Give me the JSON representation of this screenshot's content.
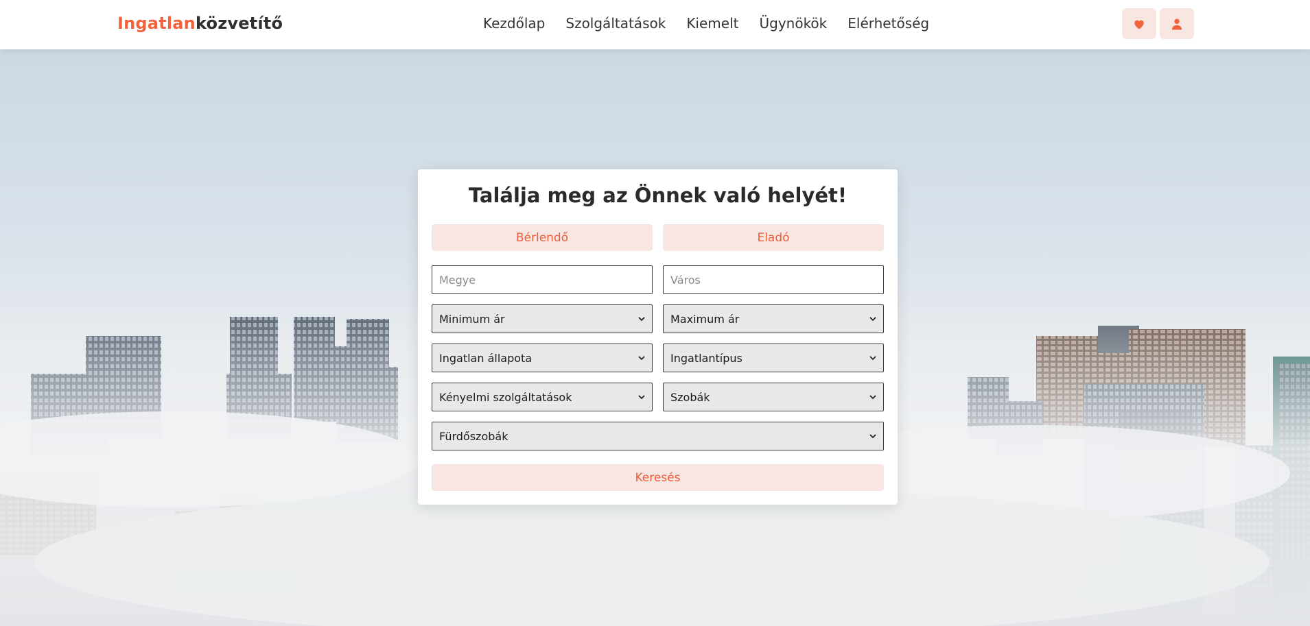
{
  "header": {
    "brand_part1": "Ingatlan",
    "brand_part2": "közvetítő",
    "nav": [
      "Kezdőlap",
      "Szolgáltatások",
      "Kiemelt",
      "Ügynökök",
      "Elérhetőség"
    ],
    "favorites_icon": "heart-icon",
    "account_icon": "user-icon"
  },
  "search": {
    "title": "Találja meg az Önnek való helyét!",
    "tabs": [
      "Bérlendő",
      "Eladó"
    ],
    "county_placeholder": "Megye",
    "city_placeholder": "Város",
    "min_price": "Minimum ár",
    "max_price": "Maximum ár",
    "condition": "Ingatlan állapota",
    "property_type": "Ingatlantípus",
    "amenities": "Kényelmi szolgáltatások",
    "rooms": "Szobák",
    "bathrooms": "Fürdőszobák",
    "submit": "Keresés"
  },
  "colors": {
    "accent": "#f0633d",
    "pill_bg": "#f8e6e3"
  }
}
